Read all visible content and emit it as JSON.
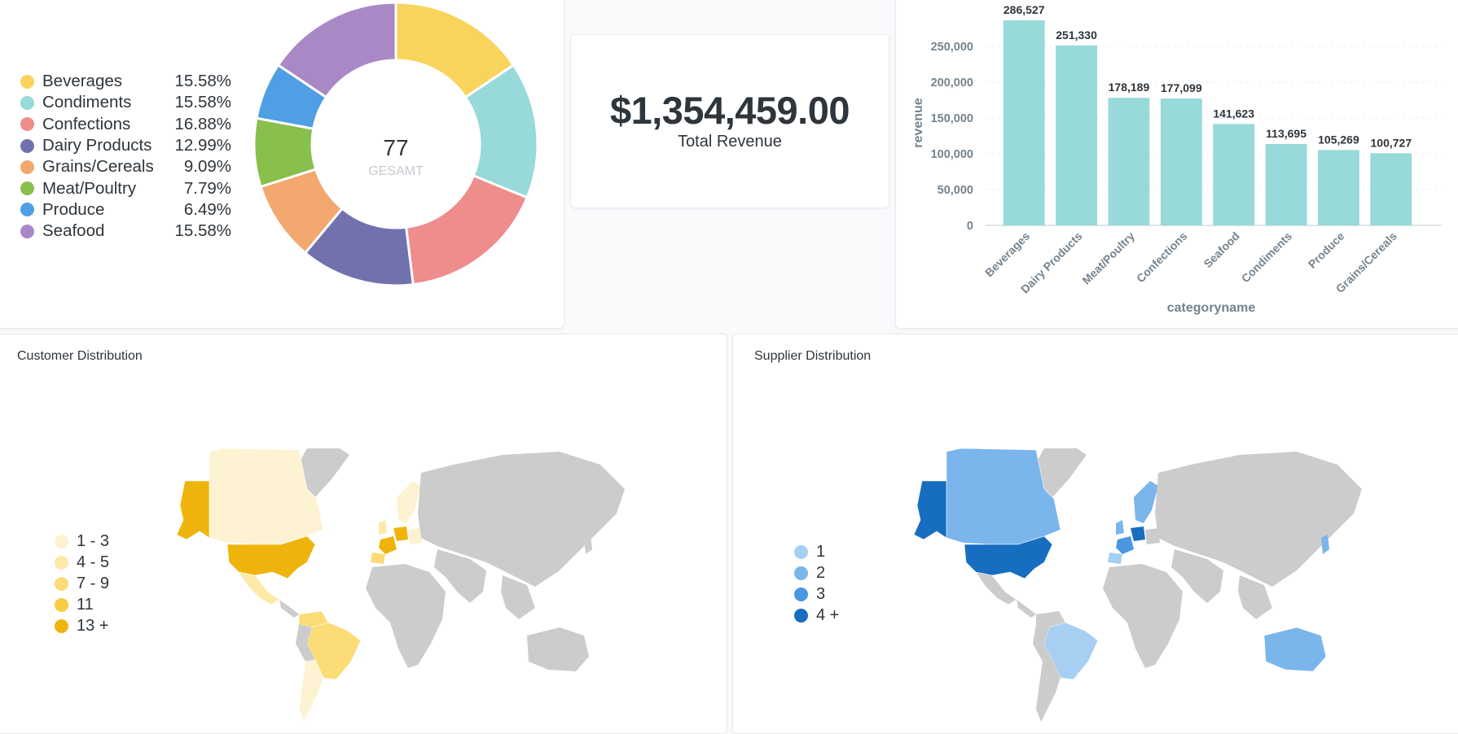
{
  "donut_card": {
    "center_value": "77",
    "center_label": "GESAMT",
    "legend": [
      {
        "label": "Beverages",
        "pct": "15.58%",
        "color": "#f9d45c"
      },
      {
        "label": "Condiments",
        "pct": "15.58%",
        "color": "#98d9d9"
      },
      {
        "label": "Confections",
        "pct": "16.88%",
        "color": "#ef8c8c"
      },
      {
        "label": "Dairy Products",
        "pct": "12.99%",
        "color": "#7172ad"
      },
      {
        "label": "Grains/Cereals",
        "pct": "9.09%",
        "color": "#f2a86f"
      },
      {
        "label": "Meat/Poultry",
        "pct": "7.79%",
        "color": "#88bf4d"
      },
      {
        "label": "Produce",
        "pct": "6.49%",
        "color": "#509ee3"
      },
      {
        "label": "Seafood",
        "pct": "15.58%",
        "color": "#a989c5"
      }
    ]
  },
  "scalar_card": {
    "value": "$1,354,459.00",
    "label": "Total Revenue"
  },
  "chart_data": [
    {
      "type": "pie",
      "categories": [
        "Beverages",
        "Condiments",
        "Confections",
        "Dairy Products",
        "Grains/Cereals",
        "Meat/Poultry",
        "Produce",
        "Seafood"
      ],
      "values": [
        15.58,
        15.58,
        16.88,
        12.99,
        9.09,
        7.79,
        6.49,
        15.58
      ],
      "total": 77,
      "total_label": "GESAMT",
      "colors": [
        "#f9d45c",
        "#98d9d9",
        "#ef8c8c",
        "#7172ad",
        "#f2a86f",
        "#88bf4d",
        "#509ee3",
        "#a989c5"
      ]
    },
    {
      "type": "bar",
      "categories": [
        "Beverages",
        "Dairy Products",
        "Meat/Poultry",
        "Confections",
        "Seafood",
        "Condiments",
        "Produce",
        "Grains/Cereals"
      ],
      "values": [
        286527,
        251330,
        178189,
        177099,
        141623,
        113695,
        105269,
        100727
      ],
      "value_labels": [
        "286,527",
        "251,330",
        "178,189",
        "177,099",
        "141,623",
        "113,695",
        "105,269",
        "100,727"
      ],
      "xlabel": "categoryname",
      "ylabel": "revenue",
      "ylim": [
        0,
        300000
      ],
      "yticks": [
        0,
        50000,
        100000,
        150000,
        200000,
        250000
      ],
      "ytick_labels": [
        "0",
        "50,000",
        "100,000",
        "150,000",
        "200,000",
        "250,000"
      ],
      "grid": true,
      "color": "#98d9d9"
    }
  ],
  "customer_card": {
    "title": "Customer Distribution",
    "legend": [
      {
        "label": "1 - 3",
        "color": "#fdf3d2"
      },
      {
        "label": "4 - 5",
        "color": "#fde9a8"
      },
      {
        "label": "7 - 9",
        "color": "#fbdc77"
      },
      {
        "label": "11",
        "color": "#f8cd42"
      },
      {
        "label": "13 +",
        "color": "#efb40c"
      }
    ]
  },
  "supplier_card": {
    "title": "Supplier Distribution",
    "legend": [
      {
        "label": "1",
        "color": "#a7cff2"
      },
      {
        "label": "2",
        "color": "#7ab5ec"
      },
      {
        "label": "3",
        "color": "#4a96e0"
      },
      {
        "label": "4 +",
        "color": "#176dc0"
      }
    ]
  }
}
